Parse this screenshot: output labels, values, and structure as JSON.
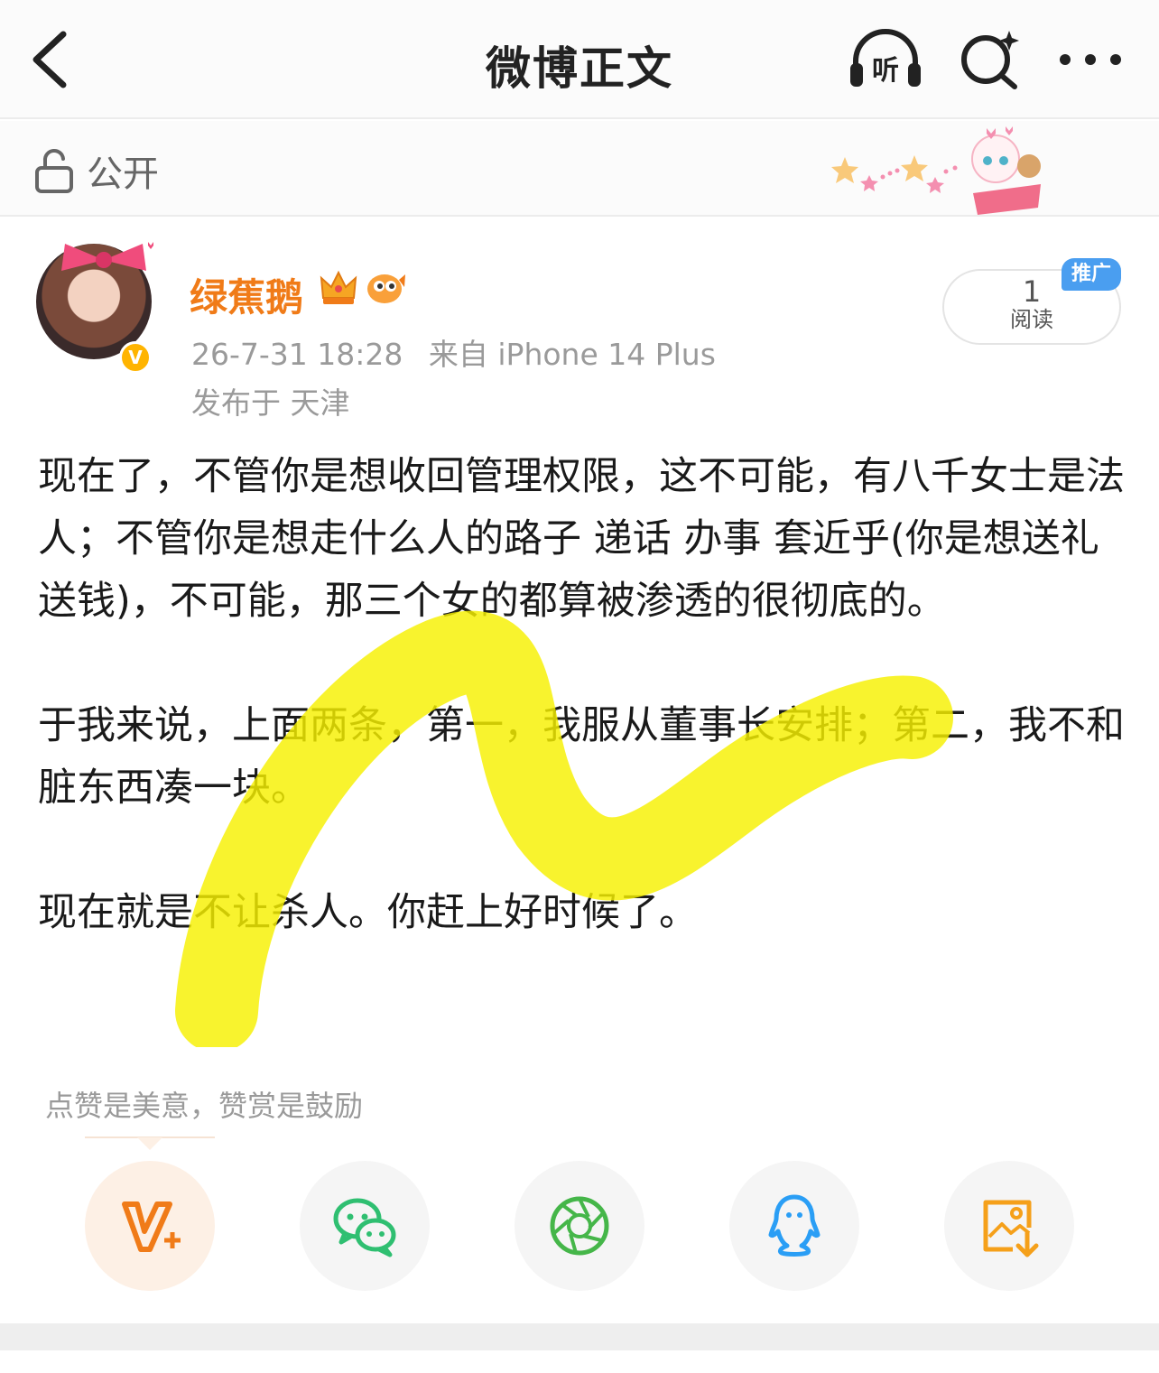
{
  "navbar": {
    "title": "微博正文",
    "back_icon": "chevron-left-icon",
    "listen_icon": "headphones-icon",
    "listen_label": "听",
    "search_icon": "search-sparkle-icon",
    "more_icon": "more-dots-icon"
  },
  "visibility": {
    "label": "公开",
    "icon": "unlock-icon"
  },
  "author": {
    "name": "绿蕉鹅",
    "timestamp": "26-7-31 18:28",
    "source": "来自 iPhone 14 Plus",
    "location": "发布于 天津",
    "verified_mark": "V"
  },
  "read": {
    "count": "1",
    "label": "阅读",
    "badge": "推广"
  },
  "post": {
    "paragraphs": [
      "现在了，不管你是想收回管理权限，这不可能，有八千女士是法人；不管你是想走什么人的路子 递话 办事 套近乎(你是想送礼 送钱)，不可能，那三个女的都算被渗透的很彻底的。",
      "于我来说，上面两条，第一，我服从董事长安排；第二，我不和脏东西凑一块。",
      "现在就是不让杀人。你赶上好时候了。"
    ]
  },
  "reward": {
    "text": "点赞是美意，赞赏是鼓励"
  },
  "share": {
    "buttons": [
      {
        "name": "vplus",
        "icon": "vplus-icon",
        "color": "#f07b18"
      },
      {
        "name": "wechat",
        "icon": "wechat-icon",
        "color": "#2fbf71"
      },
      {
        "name": "moments",
        "icon": "aperture-icon",
        "color": "#45b649"
      },
      {
        "name": "qq",
        "icon": "qq-penguin-icon",
        "color": "#2a9ef5"
      },
      {
        "name": "save-image",
        "icon": "save-image-icon",
        "color": "#f5a01a"
      }
    ]
  },
  "colors": {
    "accent_orange": "#f07b18",
    "highlight_yellow": "#f7f000",
    "badge_blue": "#4a9ef0"
  }
}
